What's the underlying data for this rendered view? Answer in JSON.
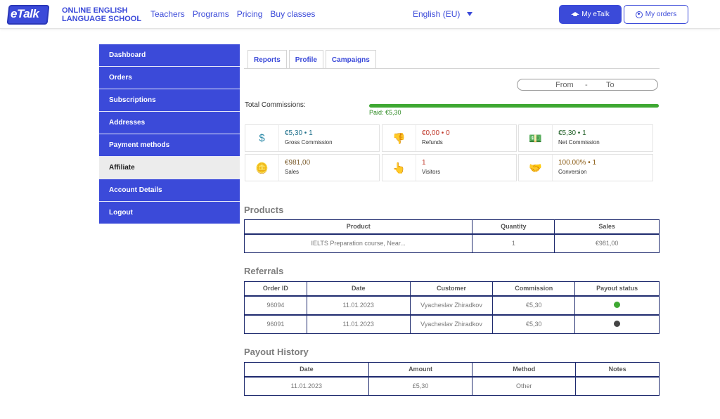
{
  "header": {
    "logo_text": "eTalk",
    "school_line1": "ONLINE ENGLISH",
    "school_line2": "LANGUAGE SCHOOL",
    "nav": [
      "Teachers",
      "Programs",
      "Pricing",
      "Buy classes"
    ],
    "language": "English (EU)",
    "my_etalk_label": "My eTalk",
    "my_orders_label": "My orders",
    "accent_color": "#3b4ad9"
  },
  "sidebar": {
    "items": [
      {
        "label": "Dashboard",
        "active": false
      },
      {
        "label": "Orders",
        "active": false
      },
      {
        "label": "Subscriptions",
        "active": false
      },
      {
        "label": "Addresses",
        "active": false
      },
      {
        "label": "Payment methods",
        "active": false
      },
      {
        "label": "Affiliate",
        "active": true
      },
      {
        "label": "Account Details",
        "active": false
      },
      {
        "label": "Logout",
        "active": false
      }
    ]
  },
  "tabs": [
    "Reports",
    "Profile",
    "Campaigns"
  ],
  "date_range": {
    "from": "From",
    "separator": "-",
    "to": "To"
  },
  "commissions": {
    "label": "Total Commissions:",
    "paid_label": "Paid: €5,30",
    "paid_fraction": 1.0,
    "bar_color": "#3ea832"
  },
  "stats": [
    {
      "icon": "dollar-icon",
      "glyph": "$",
      "value": "€5,30 • 1",
      "label": "Gross Commission",
      "color": "#1d6f8a",
      "icon_color": "#2c8aa8"
    },
    {
      "icon": "thumbs-down-icon",
      "glyph": "👎",
      "value": "€0,00 • 0",
      "label": "Refunds",
      "color": "#c0392b",
      "icon_color": "#d9443a"
    },
    {
      "icon": "money-hand-icon",
      "glyph": "💵",
      "value": "€5,30 • 1",
      "label": "Net Commission",
      "color": "#1e5e24",
      "icon_color": "#3ea832"
    },
    {
      "icon": "coins-icon",
      "glyph": "🪙",
      "value": "€981,00",
      "label": "Sales",
      "color": "#7a5a2a",
      "icon_color": "#b58a4d"
    },
    {
      "icon": "pointer-hand-icon",
      "glyph": "👆",
      "value": "1",
      "label": "Visitors",
      "color": "#c0392b",
      "icon_color": "#e06a3b"
    },
    {
      "icon": "handshake-icon",
      "glyph": "🤝",
      "value": "100.00% • 1",
      "label": "Conversion",
      "color": "#8a5a12",
      "icon_color": "#d98a2b"
    }
  ],
  "products": {
    "title": "Products",
    "headers": [
      "Product",
      "Quantity",
      "Sales"
    ],
    "rows": [
      [
        "IELTS Preparation course, Near...",
        "1",
        "€981,00"
      ]
    ]
  },
  "referrals": {
    "title": "Referrals",
    "headers": [
      "Order ID",
      "Date",
      "Customer",
      "Commission",
      "Payout status"
    ],
    "rows": [
      {
        "order_id": "96094",
        "date": "11.01.2023",
        "customer": "Vyacheslav Zhiradkov",
        "commission": "€5,30",
        "status_color": "#3ea832"
      },
      {
        "order_id": "96091",
        "date": "11.01.2023",
        "customer": "Vyacheslav Zhiradkov",
        "commission": "€5,30",
        "status_color": "#444444"
      }
    ]
  },
  "payout_history": {
    "title": "Payout History",
    "headers": [
      "Date",
      "Amount",
      "Method",
      "Notes"
    ],
    "rows": [
      [
        "11.01.2023",
        "£5,30",
        "Other",
        ""
      ]
    ]
  }
}
